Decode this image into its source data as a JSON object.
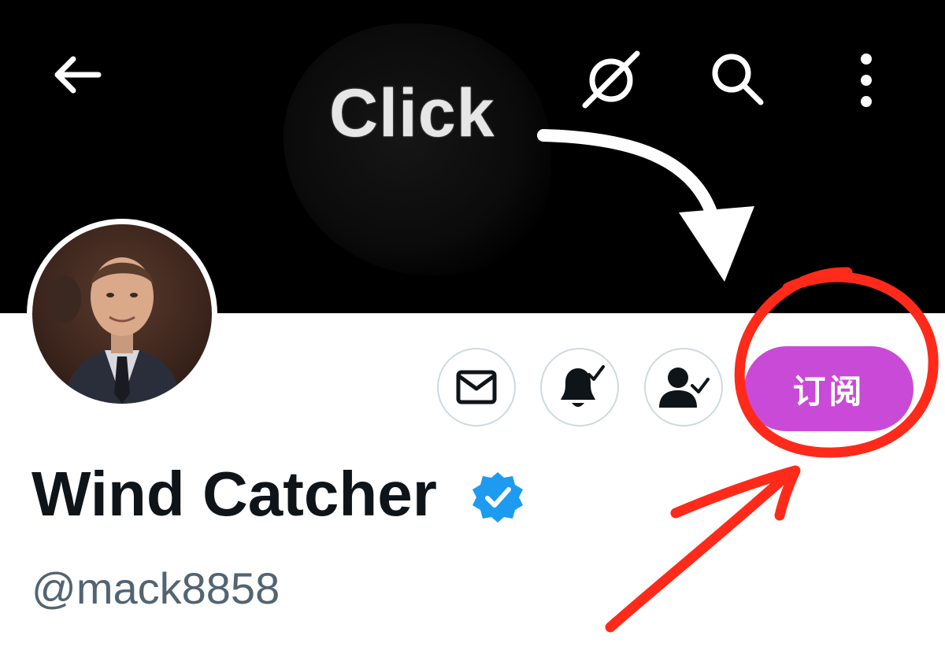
{
  "banner": {
    "overlay_text": "Click"
  },
  "header": {
    "back_icon": "arrow-left-icon",
    "grok_icon": "slash-circle-icon",
    "search_icon": "search-icon",
    "more_icon": "more-vertical-icon"
  },
  "profile": {
    "display_name": "Wind Catcher",
    "handle": "@mack8858",
    "verified": true,
    "verified_color": "#1d9bf0"
  },
  "actions": {
    "message_icon": "envelope-icon",
    "notifications_icon": "bell-check-icon",
    "following_icon": "person-check-icon",
    "subscribe_label": "订阅",
    "subscribe_color": "#c94ad6"
  },
  "annotations": {
    "circle_color": "#ff2a1a",
    "arrow_color": "#ffffff"
  }
}
